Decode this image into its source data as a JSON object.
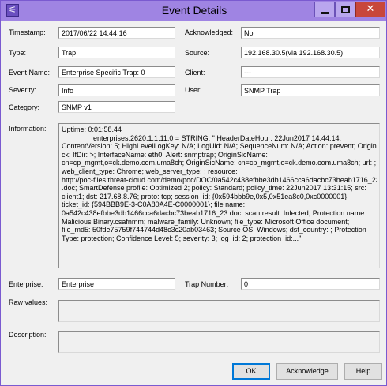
{
  "window": {
    "title": "Event Details",
    "app_icon_glyph": "⚟",
    "close_glyph": "✕"
  },
  "fields": {
    "timestamp_label": "Timestamp:",
    "timestamp_value": "2017/06/22 14:44:16",
    "acknowledged_label": "Acknowledged:",
    "acknowledged_value": "No",
    "type_label": "Type:",
    "type_value": "Trap",
    "source_label": "Source:",
    "source_value": "192.168.30.5(via 192.168.30.5)",
    "event_name_label": "Event Name:",
    "event_name_value": "Enterprise Specific Trap: 0",
    "client_label": "Client:",
    "client_value": "---",
    "severity_label": "Severity:",
    "severity_value": "Info",
    "user_label": "User:",
    "user_value": "SNMP Trap",
    "category_label": "Category:",
    "category_value": "SNMP v1",
    "information_label": "Information:",
    "enterprise_label": "Enterprise:",
    "enterprise_value": "Enterprise",
    "trap_number_label": "Trap Number:",
    "trap_number_value": "0",
    "raw_values_label": "Raw values:",
    "description_label": "Description:"
  },
  "information_lines": [
    "Uptime: 0:01:58.44",
    "                enterprises.2620.1.1.11.0 = STRING: \" HeaderDateHour: 22Jun2017 14:44:14;",
    "ContentVersion: 5; HighLevelLogKey: N/A; LogUid: N/A; SequenceNum: N/A; Action: prevent; Origin:",
    "ck; IfDir: >; InterfaceName: eth0; Alert: snmptrap; OriginSicName:",
    "cn=cp_mgmt,o=ck.demo.com.uma8ch; OriginSicName: cn=cp_mgmt,o=ck.demo.com.uma8ch; url: ;",
    "web_client_type: Chrome; web_server_type: ; resource:",
    "http://poc-files.threat-cloud.com/demo/poc/DOC/0a542c438efbbe3db1466cca6dacbc73beab1716_23",
    ".doc; SmartDefense profile: Optimized 2; policy: Standard; policy_time: 22Jun2017 13:31:15; src:",
    "client1; dst: 217.68.8.76; proto: tcp; session_id: {0x594bbb9e,0x5,0x51ea8c0,0xc0000001};",
    "ticket_id: {594BBB9E-3-C0A80A4E-C0000001}; file name:",
    "0a542c438efbbe3db1466cca6dacbc73beab1716_23.doc; scan result: Infected; Protection name:",
    "Malicious Binary.csafnmm; malware_family: Unknown; file_type: Microsoft Office document;",
    "file_md5: 50fde75759f744744d48c3c20ab03463; Source OS: Windows; dst_country: ; Protection",
    "Type: protection; Confidence Level: 5; severity: 3; log_id: 2; protection_id:...\""
  ],
  "buttons": {
    "ok": "OK",
    "acknowledge": "Acknowledge",
    "help": "Help"
  }
}
